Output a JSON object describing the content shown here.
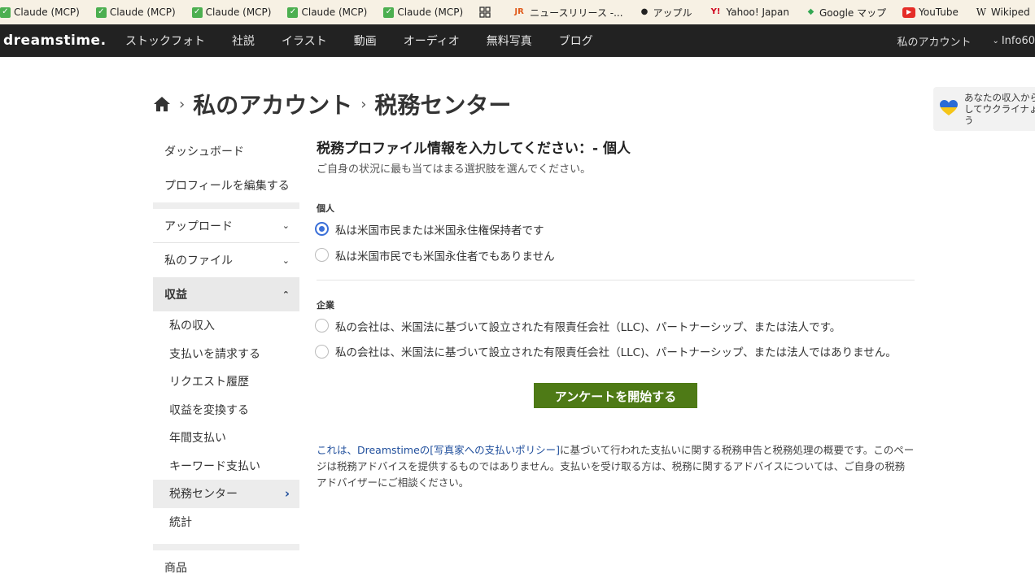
{
  "bookmarks": [
    {
      "label": "Claude (MCP)",
      "icon": "check-icon"
    },
    {
      "label": "Claude (MCP)",
      "icon": "check-icon"
    },
    {
      "label": "Claude (MCP)",
      "icon": "check-icon"
    },
    {
      "label": "Claude (MCP)",
      "icon": "check-icon"
    },
    {
      "label": "Claude (MCP)",
      "icon": "check-icon"
    }
  ],
  "bookmarks_right": {
    "jr": "ニュースリリース -...",
    "apple": "アップル",
    "yahoo": "Yahoo! Japan",
    "maps": "Google マップ",
    "youtube": "YouTube",
    "wiki": "Wikiped"
  },
  "nav": {
    "logo": "dreamstime.",
    "items": [
      "ストックフォト",
      "社説",
      "イラスト",
      "動画",
      "オーディオ",
      "無料写真",
      "ブログ"
    ],
    "account": "私のアカウント",
    "user": "Info60"
  },
  "breadcrumb": {
    "account": "私のアカウント",
    "current": "税務センター"
  },
  "sidebar": {
    "dashboard": "ダッシュボード",
    "edit_profile": "プロフィールを編集する",
    "upload": "アップロード",
    "my_files": "私のファイル",
    "earnings": "収益",
    "sub": [
      "私の収入",
      "支払いを請求する",
      "リクエスト履歴",
      "収益を変換する",
      "年間支払い",
      "キーワード支払い",
      "税務センター",
      "統計"
    ],
    "products": "商品"
  },
  "main": {
    "title": "税務プロファイル情報を入力してください：- 個人",
    "description": "ご自身の状況に最も当てはまる選択肢を選んでください。",
    "individual_label": "個人",
    "individual_options": [
      "私は米国市民または米国永住権保持者です",
      "私は米国市民でも米国永住者でもありません"
    ],
    "company_label": "企業",
    "company_options": [
      "私の会社は、米国法に基づいて設立された有限責任会社（LLC)、パートナーシップ、または法人です。",
      "私の会社は、米国法に基づいて設立された有限責任会社（LLC)、パートナーシップ、または法人ではありません。"
    ],
    "start_button": "アンケートを開始する",
    "note_prefix": "これは、Dreamstimeの",
    "note_link": "[写真家への支払いポリシー]",
    "note_suffix": "に基づいて行われた支払いに関する税務申告と税務処理の概要です。このページは税務アドバイスを提供するものではありません。支払いを受け取る方は、税務に関するアドバイスについては、ご自身の税務アドバイザーにご相談ください。"
  },
  "ukraine": {
    "text": "あなたの収入からしてウクライナょう"
  },
  "colors": {
    "navbar": "#222222",
    "button": "#4e7a16",
    "radio_selected": "#3a6fd8",
    "link": "#1f4e9c"
  }
}
